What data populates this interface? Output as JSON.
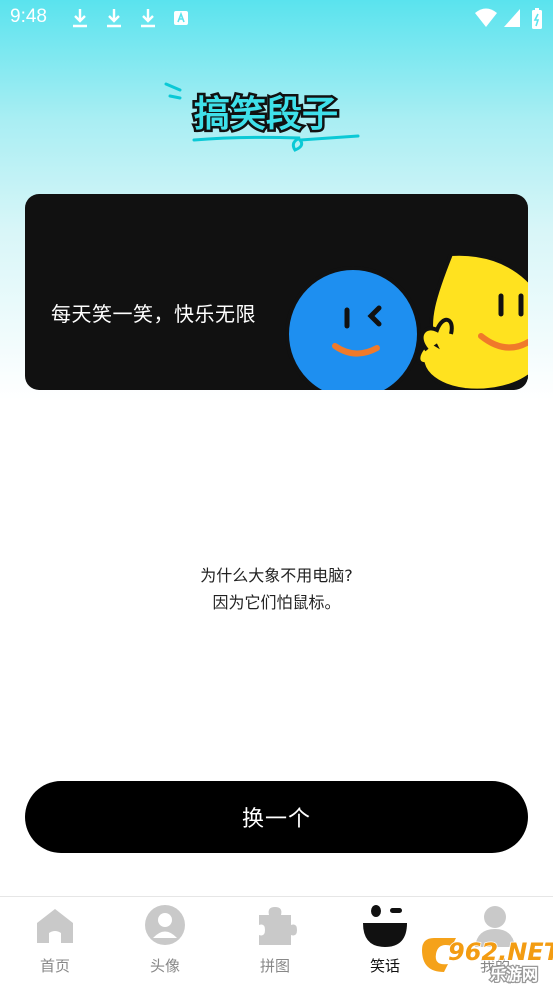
{
  "status_bar": {
    "time": "9:48"
  },
  "header": {
    "logo_text": "搞笑段子"
  },
  "banner": {
    "text": "每天笑一笑，快乐无限"
  },
  "joke": {
    "line1": "为什么大象不用电脑?",
    "line2": "因为它们怕鼠标。"
  },
  "actions": {
    "change_label": "换一个"
  },
  "bottom_nav": {
    "items": [
      {
        "label": "首页",
        "icon": "home-icon"
      },
      {
        "label": "头像",
        "icon": "avatar-icon"
      },
      {
        "label": "拼图",
        "icon": "puzzle-icon"
      },
      {
        "label": "笑话",
        "icon": "wink-face-icon"
      },
      {
        "label": "我的",
        "icon": "user-icon"
      }
    ],
    "active_index": 3
  },
  "watermark": {
    "text": "962.NET",
    "subtext": "乐游网"
  },
  "colors": {
    "accent_cyan": "#3fe0ea",
    "blue_face": "#1e8ff0",
    "yellow_face": "#ffe21f",
    "smile_orange": "#f07a2a"
  }
}
